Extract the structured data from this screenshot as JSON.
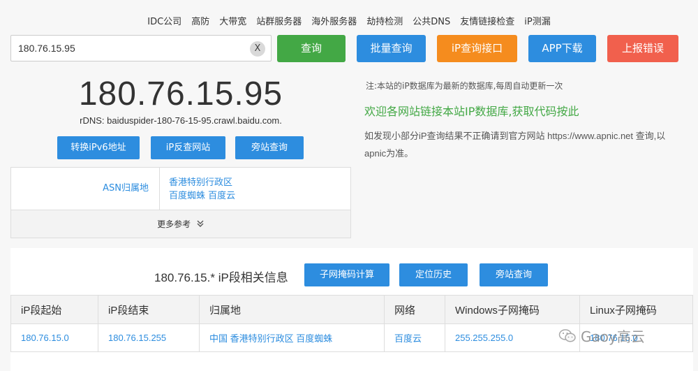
{
  "nav": [
    "IDC公司",
    "高防",
    "大带宽",
    "站群服务器",
    "海外服务器",
    "劫持检测",
    "公共DNS",
    "友情链接检查",
    "iP测漏"
  ],
  "search": {
    "value": "180.76.15.95",
    "clear": "X"
  },
  "buttons": {
    "query": "查询",
    "batch": "批量查询",
    "api": "iP查询接口",
    "app": "APP下载",
    "report": "上报错误"
  },
  "ip": "180.76.15.95",
  "rdns": "rDNS: baiduspider-180-76-15-95.crawl.baidu.com.",
  "sub_buttons": {
    "ipv6": "转换iPv6地址",
    "reverse": "iP反查网站",
    "side": "旁站查询"
  },
  "asn": {
    "label": "ASN归属地",
    "region": "香港特别行政区",
    "org1": "百度蜘蛛",
    "org2": "百度云",
    "more": "更多参考"
  },
  "notes": {
    "db": "注:本站的iP数据库为最新的数据库,每周自动更新一次",
    "welcome": "欢迎各网站链接本站IP数据库,获取代码按此",
    "apnic": "如发现小部分iP查询结果不正确请到官方网站 https://www.apnic.net 查询,以apnic为准。"
  },
  "segment": {
    "title": "180.76.15.* iP段相关信息",
    "buttons": [
      "子网掩码计算",
      "定位历史",
      "旁站查询"
    ],
    "headers": [
      "iP段起始",
      "iP段结束",
      "归属地",
      "网络",
      "Windows子网掩码",
      "Linux子网掩码"
    ],
    "row": [
      "180.76.15.0",
      "180.76.15.255",
      "中国 香港特别行政区 百度蜘蛛",
      "百度云",
      "255.255.255.0",
      "180.76.15.0"
    ]
  },
  "watermark": "Gaoy高云"
}
